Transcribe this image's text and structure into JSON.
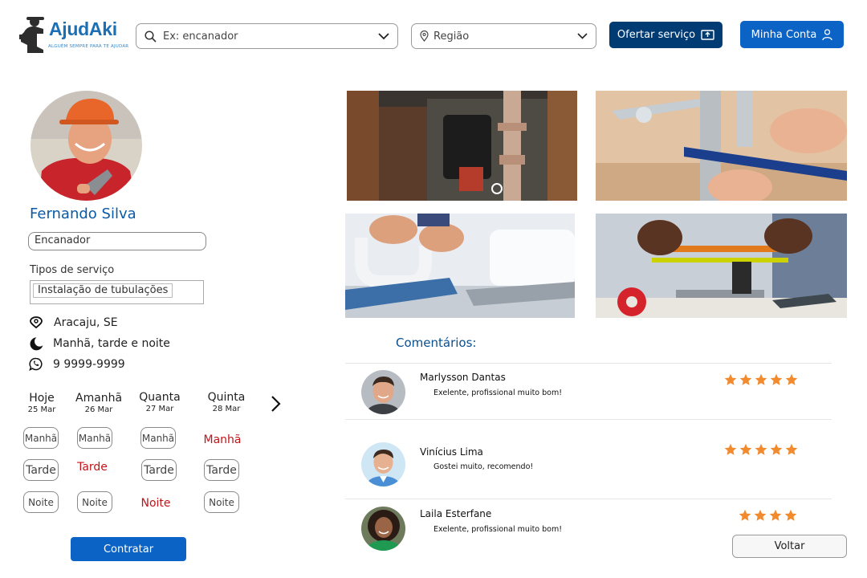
{
  "header": {
    "logo_text": "AjudAki",
    "logo_tagline": "ALGUÉM SEMPRE PARA TE AJUDAR",
    "search_placeholder": "Ex: encanador",
    "region_placeholder": "Região",
    "offer_button": "Ofertar serviço",
    "account_button": "Minha Conta"
  },
  "profile": {
    "name": "Fernando Silva",
    "profession": "Encanador",
    "types_label": "Tipos de serviço",
    "types": [
      "Instalação de tubulações"
    ],
    "location": "Aracaju, SE",
    "availability": "Manhã, tarde e noite",
    "phone": "9 9999-9999"
  },
  "schedule": {
    "days": [
      {
        "day": "Hoje",
        "date": "25 Mar"
      },
      {
        "day": "Amanhã",
        "date": "26 Mar"
      },
      {
        "day": "Quanta",
        "date": "27 Mar"
      },
      {
        "day": "Quinta",
        "date": "28 Mar"
      }
    ],
    "slots": {
      "morning": "Manhã",
      "afternoon": "Tarde",
      "night": "Noite"
    },
    "selected_color": "#c0141b",
    "hire_button": "Contratar"
  },
  "comments": {
    "title": "Comentários:",
    "items": [
      {
        "name": "Marlysson Dantas",
        "text": "Exelente, profissional muito bom!",
        "rating": 5
      },
      {
        "name": "Vinícius Lima",
        "text": "Gostei muito, recomendo!",
        "rating": 5
      },
      {
        "name": "Laila Esterfane",
        "text": "Exelente, profissional muito bom!",
        "rating": 4
      }
    ],
    "back_button": "Voltar"
  },
  "colors": {
    "primary": "#0b63c5",
    "dark_primary": "#003b73",
    "star": "#f28a2e",
    "name": "#0a5aa6"
  }
}
